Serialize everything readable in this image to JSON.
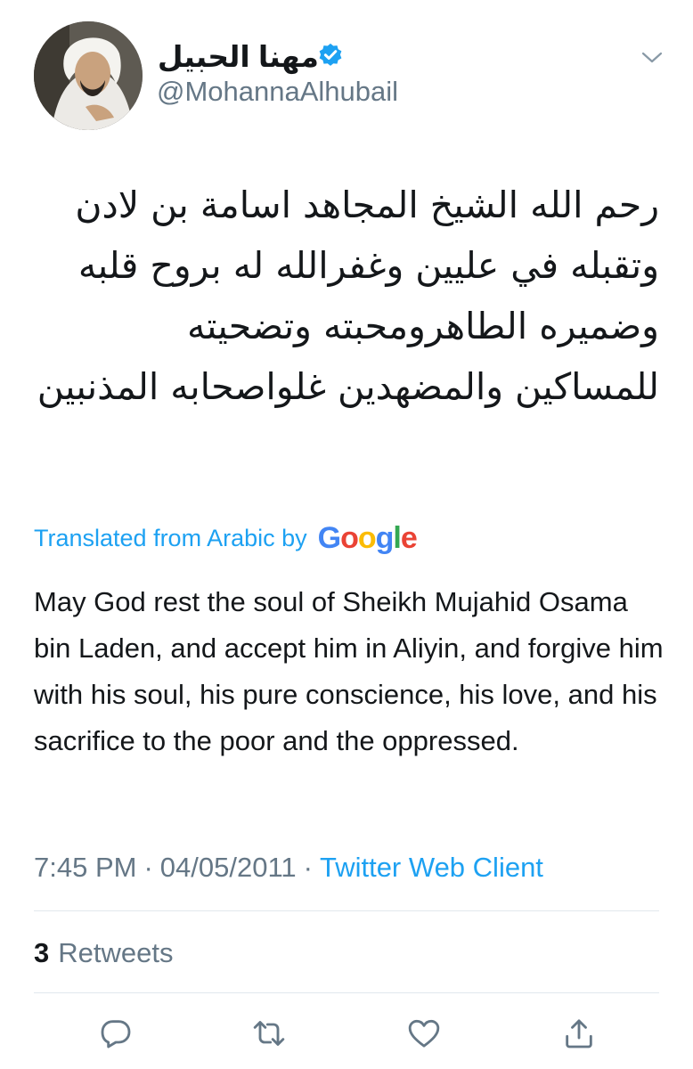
{
  "tweet": {
    "display_name": "مهنا الحبيل",
    "handle": "@MohannaAlhubail",
    "verified_icon": "verified-badge-icon",
    "menu_icon": "chevron-down-icon",
    "arabic_text": "رحم الله الشيخ المجاهد اسامة بن لادن وتقبله في عليين وغفرالله له بروح قلبه وضميره الطاهرومحبته وتضحيته للمساكين والمضهدين غلواصحابه المذنبين",
    "translated_label": "Translated from Arabic by",
    "google_letters": [
      {
        "ch": "G",
        "color": "#4285f4"
      },
      {
        "ch": "o",
        "color": "#ea4335"
      },
      {
        "ch": "o",
        "color": "#fbbc05"
      },
      {
        "ch": "g",
        "color": "#4285f4"
      },
      {
        "ch": "l",
        "color": "#34a853"
      },
      {
        "ch": "e",
        "color": "#ea4335"
      }
    ],
    "translation": "May God rest the soul of Sheikh Mujahid Osama bin Laden, and accept him in Aliyin, and forgive him with his soul, his pure conscience, his love, and his sacrifice to the poor and the oppressed.",
    "time": "7:45 PM",
    "date": "04/05/2011",
    "separator": "·",
    "source": "Twitter Web Client",
    "retweet_count": "3",
    "retweets_label": "Retweets"
  },
  "actions": [
    {
      "name": "reply-icon",
      "label": "Reply"
    },
    {
      "name": "retweet-icon",
      "label": "Retweet"
    },
    {
      "name": "like-icon",
      "label": "Like"
    },
    {
      "name": "share-icon",
      "label": "Share"
    }
  ],
  "colors": {
    "accent": "#1da1f2",
    "secondary": "#657786",
    "text": "#14171a",
    "divider": "#e1e8ed"
  }
}
